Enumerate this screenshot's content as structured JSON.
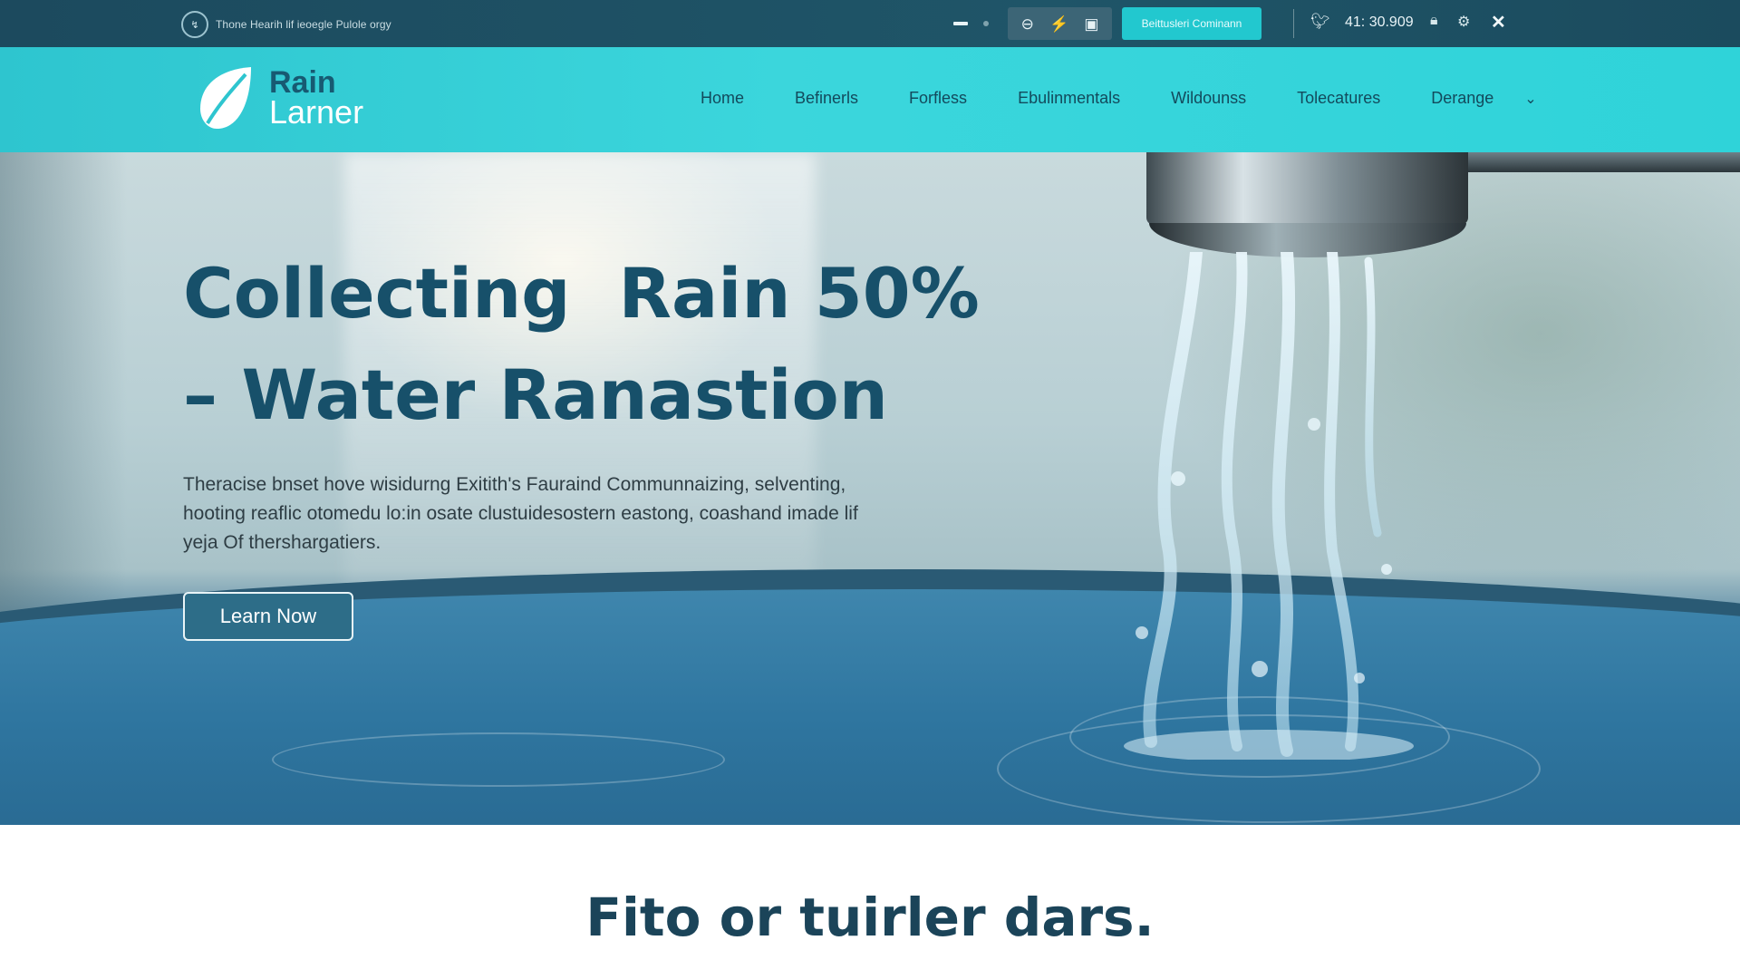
{
  "topbar": {
    "tagline": "Thone Hearih lif ieoegle Pulole orgy",
    "mini_logo_text": "↯",
    "icons": [
      "minus-circle-icon",
      "bolt-icon",
      "briefcase-icon"
    ],
    "cta_label": "Beittusleri Cominann",
    "clock": "41: 30.909"
  },
  "brand": {
    "word1": "Rain",
    "word2": "Larner"
  },
  "nav": {
    "items": [
      "Home",
      "Befinerls",
      "Forfless",
      "Ebulinmentals",
      "Wildounss",
      "Tolecatures",
      "Derange"
    ]
  },
  "hero": {
    "title_line1": "Collecting  Rain 50%",
    "title_line2": "– Water Ranastion",
    "lead": "Theracise bnset hove wisidurng Exitith's Fauraind Communnaizing, selventing, hooting reaflic otomedu lo:in osate clustuidesostern eastong, coashand imade lif yeja Of thershargatiers.",
    "button_label": "Learn Now"
  },
  "section": {
    "title": "Fito or tuirler dars."
  },
  "colors": {
    "topbar": "#1c4a5e",
    "nav": "#35d0d8",
    "accent_button": "#22c8cf",
    "heading": "#17506a"
  }
}
